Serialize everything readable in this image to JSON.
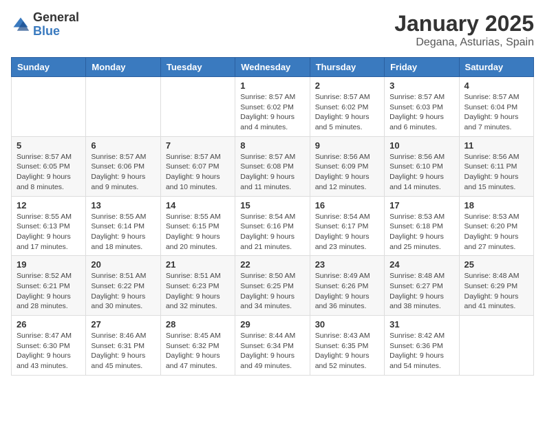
{
  "header": {
    "logo_general": "General",
    "logo_blue": "Blue",
    "month_title": "January 2025",
    "location": "Degana, Asturias, Spain"
  },
  "days_of_week": [
    "Sunday",
    "Monday",
    "Tuesday",
    "Wednesday",
    "Thursday",
    "Friday",
    "Saturday"
  ],
  "weeks": [
    [
      {
        "day": "",
        "info": ""
      },
      {
        "day": "",
        "info": ""
      },
      {
        "day": "",
        "info": ""
      },
      {
        "day": "1",
        "info": "Sunrise: 8:57 AM\nSunset: 6:02 PM\nDaylight: 9 hours\nand 4 minutes."
      },
      {
        "day": "2",
        "info": "Sunrise: 8:57 AM\nSunset: 6:02 PM\nDaylight: 9 hours\nand 5 minutes."
      },
      {
        "day": "3",
        "info": "Sunrise: 8:57 AM\nSunset: 6:03 PM\nDaylight: 9 hours\nand 6 minutes."
      },
      {
        "day": "4",
        "info": "Sunrise: 8:57 AM\nSunset: 6:04 PM\nDaylight: 9 hours\nand 7 minutes."
      }
    ],
    [
      {
        "day": "5",
        "info": "Sunrise: 8:57 AM\nSunset: 6:05 PM\nDaylight: 9 hours\nand 8 minutes."
      },
      {
        "day": "6",
        "info": "Sunrise: 8:57 AM\nSunset: 6:06 PM\nDaylight: 9 hours\nand 9 minutes."
      },
      {
        "day": "7",
        "info": "Sunrise: 8:57 AM\nSunset: 6:07 PM\nDaylight: 9 hours\nand 10 minutes."
      },
      {
        "day": "8",
        "info": "Sunrise: 8:57 AM\nSunset: 6:08 PM\nDaylight: 9 hours\nand 11 minutes."
      },
      {
        "day": "9",
        "info": "Sunrise: 8:56 AM\nSunset: 6:09 PM\nDaylight: 9 hours\nand 12 minutes."
      },
      {
        "day": "10",
        "info": "Sunrise: 8:56 AM\nSunset: 6:10 PM\nDaylight: 9 hours\nand 14 minutes."
      },
      {
        "day": "11",
        "info": "Sunrise: 8:56 AM\nSunset: 6:11 PM\nDaylight: 9 hours\nand 15 minutes."
      }
    ],
    [
      {
        "day": "12",
        "info": "Sunrise: 8:55 AM\nSunset: 6:13 PM\nDaylight: 9 hours\nand 17 minutes."
      },
      {
        "day": "13",
        "info": "Sunrise: 8:55 AM\nSunset: 6:14 PM\nDaylight: 9 hours\nand 18 minutes."
      },
      {
        "day": "14",
        "info": "Sunrise: 8:55 AM\nSunset: 6:15 PM\nDaylight: 9 hours\nand 20 minutes."
      },
      {
        "day": "15",
        "info": "Sunrise: 8:54 AM\nSunset: 6:16 PM\nDaylight: 9 hours\nand 21 minutes."
      },
      {
        "day": "16",
        "info": "Sunrise: 8:54 AM\nSunset: 6:17 PM\nDaylight: 9 hours\nand 23 minutes."
      },
      {
        "day": "17",
        "info": "Sunrise: 8:53 AM\nSunset: 6:18 PM\nDaylight: 9 hours\nand 25 minutes."
      },
      {
        "day": "18",
        "info": "Sunrise: 8:53 AM\nSunset: 6:20 PM\nDaylight: 9 hours\nand 27 minutes."
      }
    ],
    [
      {
        "day": "19",
        "info": "Sunrise: 8:52 AM\nSunset: 6:21 PM\nDaylight: 9 hours\nand 28 minutes."
      },
      {
        "day": "20",
        "info": "Sunrise: 8:51 AM\nSunset: 6:22 PM\nDaylight: 9 hours\nand 30 minutes."
      },
      {
        "day": "21",
        "info": "Sunrise: 8:51 AM\nSunset: 6:23 PM\nDaylight: 9 hours\nand 32 minutes."
      },
      {
        "day": "22",
        "info": "Sunrise: 8:50 AM\nSunset: 6:25 PM\nDaylight: 9 hours\nand 34 minutes."
      },
      {
        "day": "23",
        "info": "Sunrise: 8:49 AM\nSunset: 6:26 PM\nDaylight: 9 hours\nand 36 minutes."
      },
      {
        "day": "24",
        "info": "Sunrise: 8:48 AM\nSunset: 6:27 PM\nDaylight: 9 hours\nand 38 minutes."
      },
      {
        "day": "25",
        "info": "Sunrise: 8:48 AM\nSunset: 6:29 PM\nDaylight: 9 hours\nand 41 minutes."
      }
    ],
    [
      {
        "day": "26",
        "info": "Sunrise: 8:47 AM\nSunset: 6:30 PM\nDaylight: 9 hours\nand 43 minutes."
      },
      {
        "day": "27",
        "info": "Sunrise: 8:46 AM\nSunset: 6:31 PM\nDaylight: 9 hours\nand 45 minutes."
      },
      {
        "day": "28",
        "info": "Sunrise: 8:45 AM\nSunset: 6:32 PM\nDaylight: 9 hours\nand 47 minutes."
      },
      {
        "day": "29",
        "info": "Sunrise: 8:44 AM\nSunset: 6:34 PM\nDaylight: 9 hours\nand 49 minutes."
      },
      {
        "day": "30",
        "info": "Sunrise: 8:43 AM\nSunset: 6:35 PM\nDaylight: 9 hours\nand 52 minutes."
      },
      {
        "day": "31",
        "info": "Sunrise: 8:42 AM\nSunset: 6:36 PM\nDaylight: 9 hours\nand 54 minutes."
      },
      {
        "day": "",
        "info": ""
      }
    ]
  ]
}
